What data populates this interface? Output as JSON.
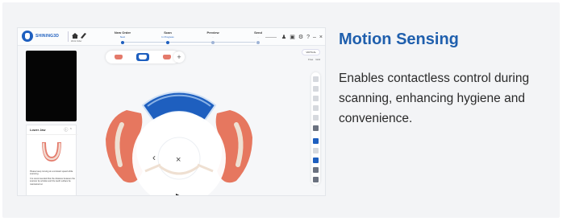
{
  "card": {
    "title": "Motion Sensing",
    "description": "Enables contactless control during scanning, enhancing hygiene and convenience."
  },
  "app": {
    "brand": "SHINING3D",
    "home_sub": "Work Order",
    "steps": [
      {
        "title": "New Order",
        "status": "Next"
      },
      {
        "title": "Scan",
        "status": "In Progress"
      },
      {
        "title": "Preview",
        "status": "-"
      },
      {
        "title": "Send",
        "status": "-"
      }
    ],
    "window_icons": [
      "user-icon",
      "screen-icon",
      "gear-icon",
      "help-icon",
      "minimize-icon",
      "close-icon"
    ],
    "view_badge": "VIRTUAL",
    "view_toggles": [
      "Free",
      "Grid"
    ],
    "panel": {
      "title": "Lower Jaw",
      "notes": [
        "Please keep moving at a constant speed while scanning.",
        "It is recommended that the distance between the scanner tip window and the teeth surface be maintained at"
      ]
    },
    "gesture_menu": {
      "left": "‹",
      "center": "×",
      "bottom": "▶"
    },
    "add_label": "+",
    "colors": {
      "brand": "#1e5fbf",
      "headline": "#1f5fad",
      "gum": "#e47a6b",
      "tooth": "#efe0d2"
    }
  }
}
